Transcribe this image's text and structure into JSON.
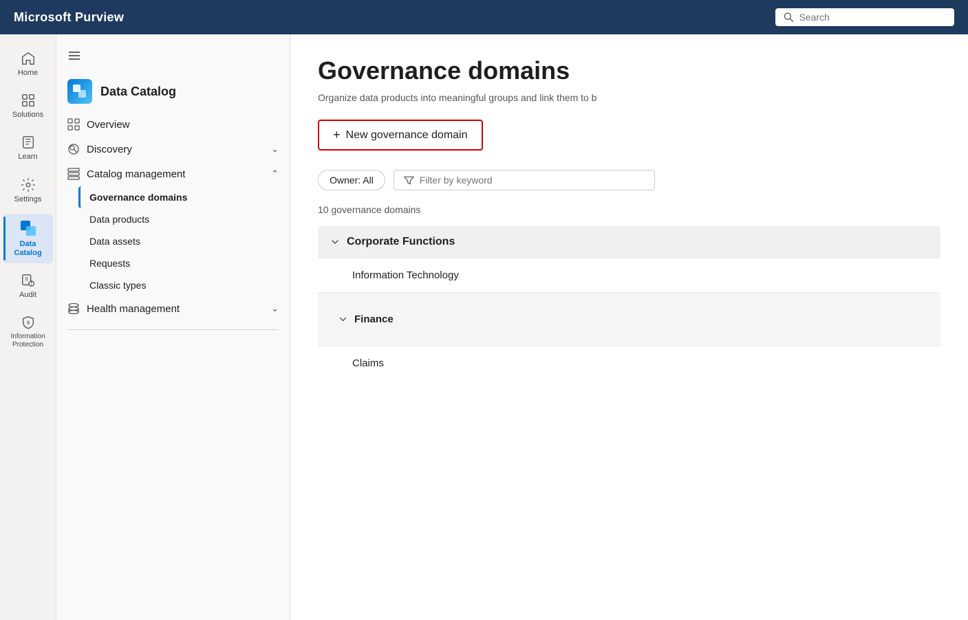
{
  "topbar": {
    "title": "Microsoft Purview",
    "search_placeholder": "Search"
  },
  "icon_nav": {
    "items": [
      {
        "id": "home",
        "label": "Home",
        "icon": "home"
      },
      {
        "id": "solutions",
        "label": "Solutions",
        "icon": "grid"
      },
      {
        "id": "learn",
        "label": "Learn",
        "icon": "book"
      },
      {
        "id": "settings",
        "label": "Settings",
        "icon": "gear"
      },
      {
        "id": "data-catalog",
        "label": "Data Catalog",
        "icon": "catalog",
        "active": true
      },
      {
        "id": "audit",
        "label": "Audit",
        "icon": "audit"
      },
      {
        "id": "info-protection",
        "label": "Information Protection",
        "icon": "protection"
      }
    ]
  },
  "side_menu": {
    "header": "Data Catalog",
    "items": [
      {
        "id": "overview",
        "label": "Overview",
        "icon": "grid-small",
        "expandable": false
      },
      {
        "id": "discovery",
        "label": "Discovery",
        "icon": "search-circle",
        "expandable": true,
        "expanded": false
      },
      {
        "id": "catalog-management",
        "label": "Catalog management",
        "icon": "book-page",
        "expandable": true,
        "expanded": true,
        "children": [
          {
            "id": "governance-domains",
            "label": "Governance domains",
            "active": true
          },
          {
            "id": "data-products",
            "label": "Data products"
          },
          {
            "id": "data-assets",
            "label": "Data assets"
          },
          {
            "id": "requests",
            "label": "Requests"
          },
          {
            "id": "classic-types",
            "label": "Classic types"
          }
        ]
      },
      {
        "id": "health-management",
        "label": "Health management",
        "icon": "cylinder",
        "expandable": true,
        "expanded": false
      }
    ]
  },
  "main": {
    "page_title": "Governance domains",
    "page_subtitle": "Organize data products into meaningful groups and link them to b",
    "new_domain_btn": "+ New governance domain",
    "filter_owner_label": "Owner: All",
    "filter_placeholder": "Filter by keyword",
    "domain_count": "10 governance domains",
    "domains": [
      {
        "id": "corporate-functions",
        "label": "Corporate Functions",
        "expanded": true,
        "children": [
          {
            "id": "information-technology",
            "label": "Information Technology",
            "isGroup": false
          },
          {
            "id": "finance",
            "label": "Finance",
            "expanded": true,
            "isGroup": true
          },
          {
            "id": "claims",
            "label": "Claims",
            "isGroup": false
          }
        ]
      }
    ]
  }
}
